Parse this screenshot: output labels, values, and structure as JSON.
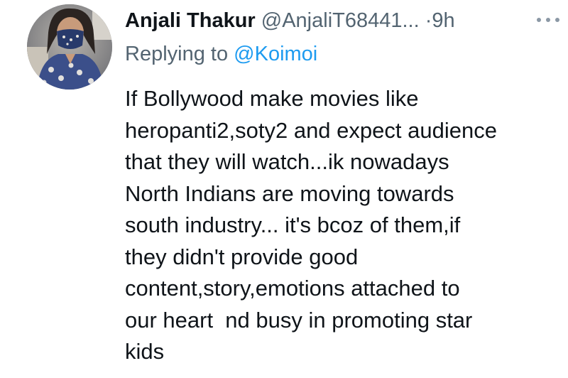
{
  "tweet": {
    "display_name": "Anjali Thakur",
    "handle": "@AnjaliT68441...",
    "separator": "·",
    "time": "9h",
    "more_icon": "more-horizontal-icon",
    "replying_prefix": "Replying to ",
    "replying_to": "@Koimoi",
    "body_lines": [
      "If Bollywood make movies like",
      "heropanti2,soty2 and expect audience",
      "that they will watch...ik nowadays",
      "North Indians are moving towards",
      "south industry... it's bcoz of them,if",
      "they didn't provide good",
      "content,story,emotions attached to",
      "our heart  nd busy in promoting star",
      "kids"
    ]
  },
  "colors": {
    "text_primary": "#0f1419",
    "text_secondary": "#536471",
    "accent": "#1d9bf0"
  }
}
